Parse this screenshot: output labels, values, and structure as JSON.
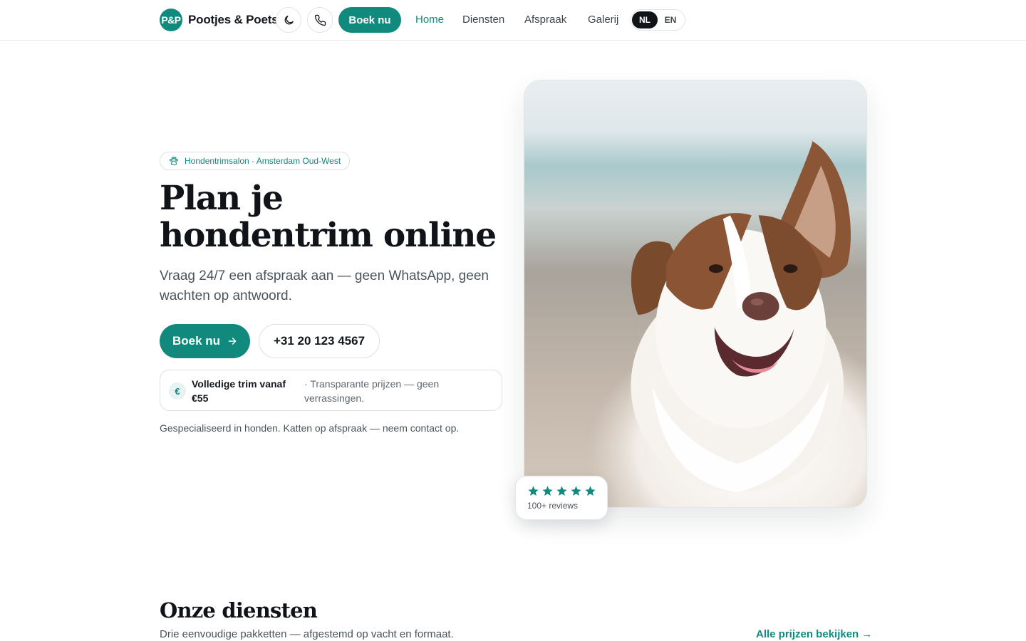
{
  "header": {
    "logo_text": "P&P",
    "brand": "Pootjes & Poets",
    "book_label": "Boek nu",
    "nav": [
      {
        "label": "Home",
        "active": true
      },
      {
        "label": "Diensten",
        "active": false
      },
      {
        "label": "Afspraak",
        "active": false
      },
      {
        "label": "Galerij",
        "active": false
      }
    ],
    "languages": [
      {
        "label": "NL",
        "active": true
      },
      {
        "label": "EN",
        "active": false
      }
    ],
    "icons": {
      "theme": "moon-icon",
      "phone": "phone-icon"
    }
  },
  "hero": {
    "chip": "Hondentrimsalon · Amsterdam Oud-West",
    "title": "Plan je hondentrim online",
    "lead": "Vraag 24/7 een afspraak aan — geen WhatsApp, geen wachten op antwoord.",
    "book_label": "Boek nu",
    "phone": "+31 20 123 4567",
    "price_symbol": "€",
    "price_main": "Volledige trim vanaf €55",
    "price_note": "· Transparante prijzen — geen verrassingen.",
    "specialty": "Gespecialiseerd in honden. Katten op afspraak — neem contact op.",
    "rating_stars": 5,
    "reviews": "100+ reviews"
  },
  "services": {
    "title": "Onze diensten",
    "subtitle": "Drie eenvoudige pakketten — afgestemd op vacht en formaat.",
    "link": "Alle prijzen bekijken →"
  },
  "colors": {
    "accent": "#11897c",
    "text": "#101418",
    "muted": "#4a535b",
    "border": "#dde1e4"
  }
}
